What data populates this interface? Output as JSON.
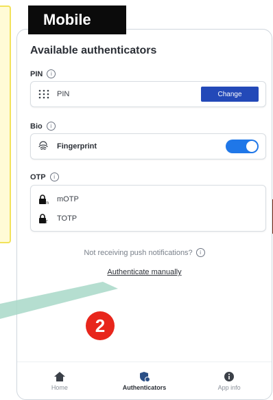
{
  "badge": {
    "text": "Mobile"
  },
  "title": "Available authenticators",
  "sections": {
    "pin": {
      "label": "PIN",
      "item": "PIN",
      "button": "Change"
    },
    "bio": {
      "label": "Bio",
      "item": "Fingerprint",
      "toggle_on": true
    },
    "otp": {
      "label": "OTP",
      "items": [
        "mOTP",
        "TOTP"
      ]
    }
  },
  "push_note": "Not receiving push notifications?",
  "manual_link": "Authenticate manually",
  "step": "2",
  "nav": {
    "home": "Home",
    "authenticators": "Authenticators",
    "app_info": "App info"
  },
  "colors": {
    "primary": "#2349b8",
    "toggle": "#1f77e8",
    "step_badge": "#e8261c"
  }
}
